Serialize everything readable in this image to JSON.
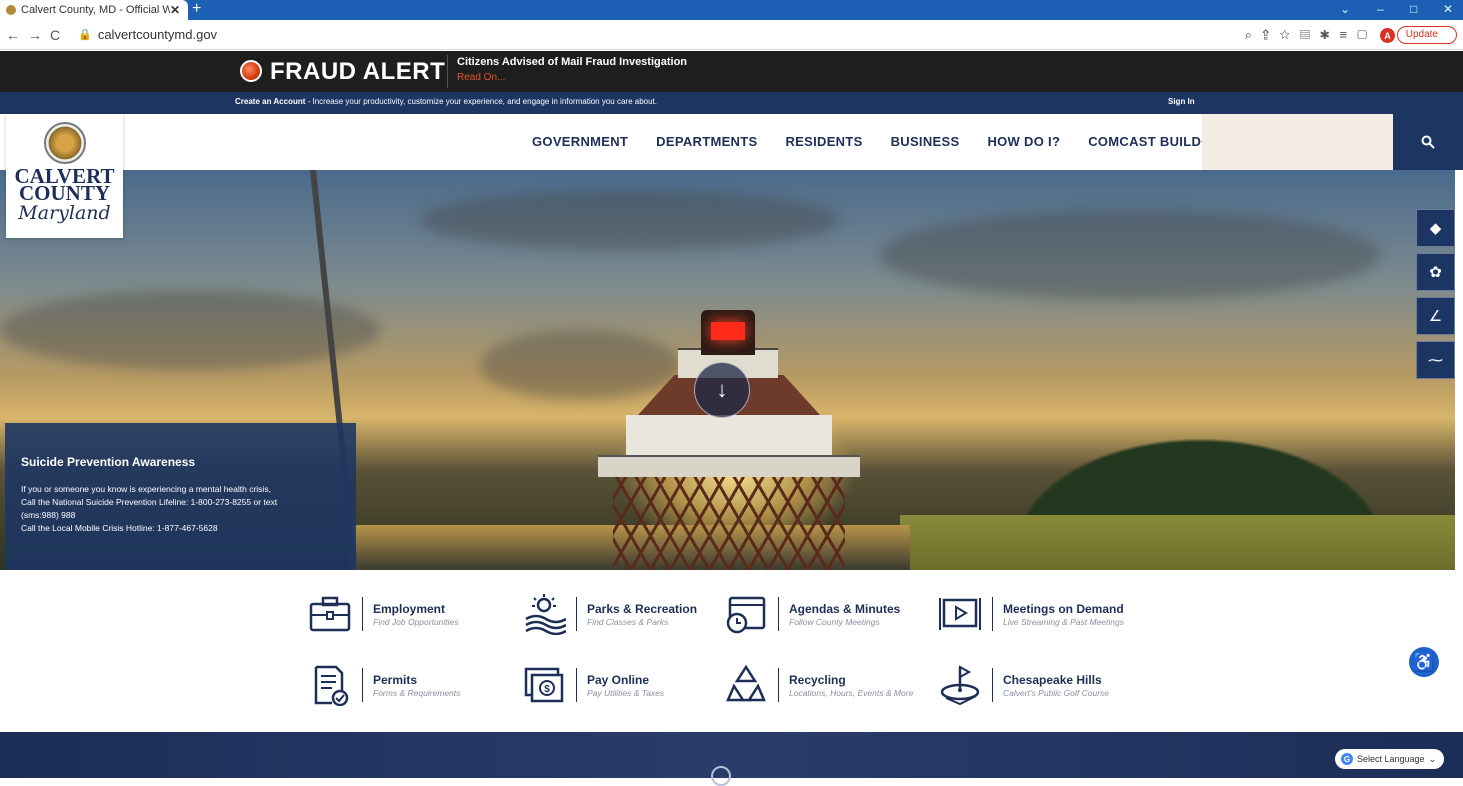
{
  "browser": {
    "tab_title": "Calvert County, MD - Official We",
    "tab_close": "✕",
    "new_tab": "+",
    "url": "calvertcountymd.gov",
    "avatar_letter": "A",
    "update_label": "Update"
  },
  "alert": {
    "title": "FRAUD ALERT",
    "message": "Citizens Advised of Mail Fraud Investigation",
    "link": "Read On..."
  },
  "account_bar": {
    "create_label": "Create an Account",
    "text": " - Increase your productivity, customize your experience, and engage in information you care about.",
    "sign_in": "Sign In"
  },
  "logo": {
    "line1": "CALVERT",
    "line2": "COUNTY",
    "line3": "Maryland"
  },
  "nav": {
    "items": [
      "GOVERNMENT",
      "DEPARTMENTS",
      "RESIDENTS",
      "BUSINESS",
      "HOW DO I?",
      "COMCAST BUILDOUT"
    ]
  },
  "hero": {
    "scroll_icon": "↓",
    "notice_title": "Suicide Prevention Awareness",
    "notice_line1": "If you or someone you know is experiencing a mental health crisis,",
    "notice_line2": "Call the National Suicide Prevention Lifeline: 1-800-273-8255 or text",
    "notice_line3": "(sms:988) 988",
    "notice_line4": "Call the Local Mobile Crisis Hotline: 1-877-467-5628"
  },
  "quick_links": [
    {
      "title": "Employment",
      "subtitle": "Find Job Opportunities"
    },
    {
      "title": "Parks & Recreation",
      "subtitle": "Find Classes & Parks"
    },
    {
      "title": "Agendas & Minutes",
      "subtitle": "Follow County Meetings"
    },
    {
      "title": "Meetings on Demand",
      "subtitle": "Live Streaming & Past Meetings"
    },
    {
      "title": "Permits",
      "subtitle": "Forms & Requirements"
    },
    {
      "title": "Pay Online",
      "subtitle": "Pay Utilities & Taxes"
    },
    {
      "title": "Recycling",
      "subtitle": "Locations, Hours, Events & More"
    },
    {
      "title": "Chesapeake Hills",
      "subtitle": "Calvert's Public Golf Course"
    }
  ],
  "language": {
    "label": "Select Language",
    "g": "G"
  },
  "colors": {
    "navy": "#1d3563",
    "alert_bg": "#1e1e1e",
    "alert_link": "#e0562b",
    "browser_blue": "#1d5fb4"
  }
}
